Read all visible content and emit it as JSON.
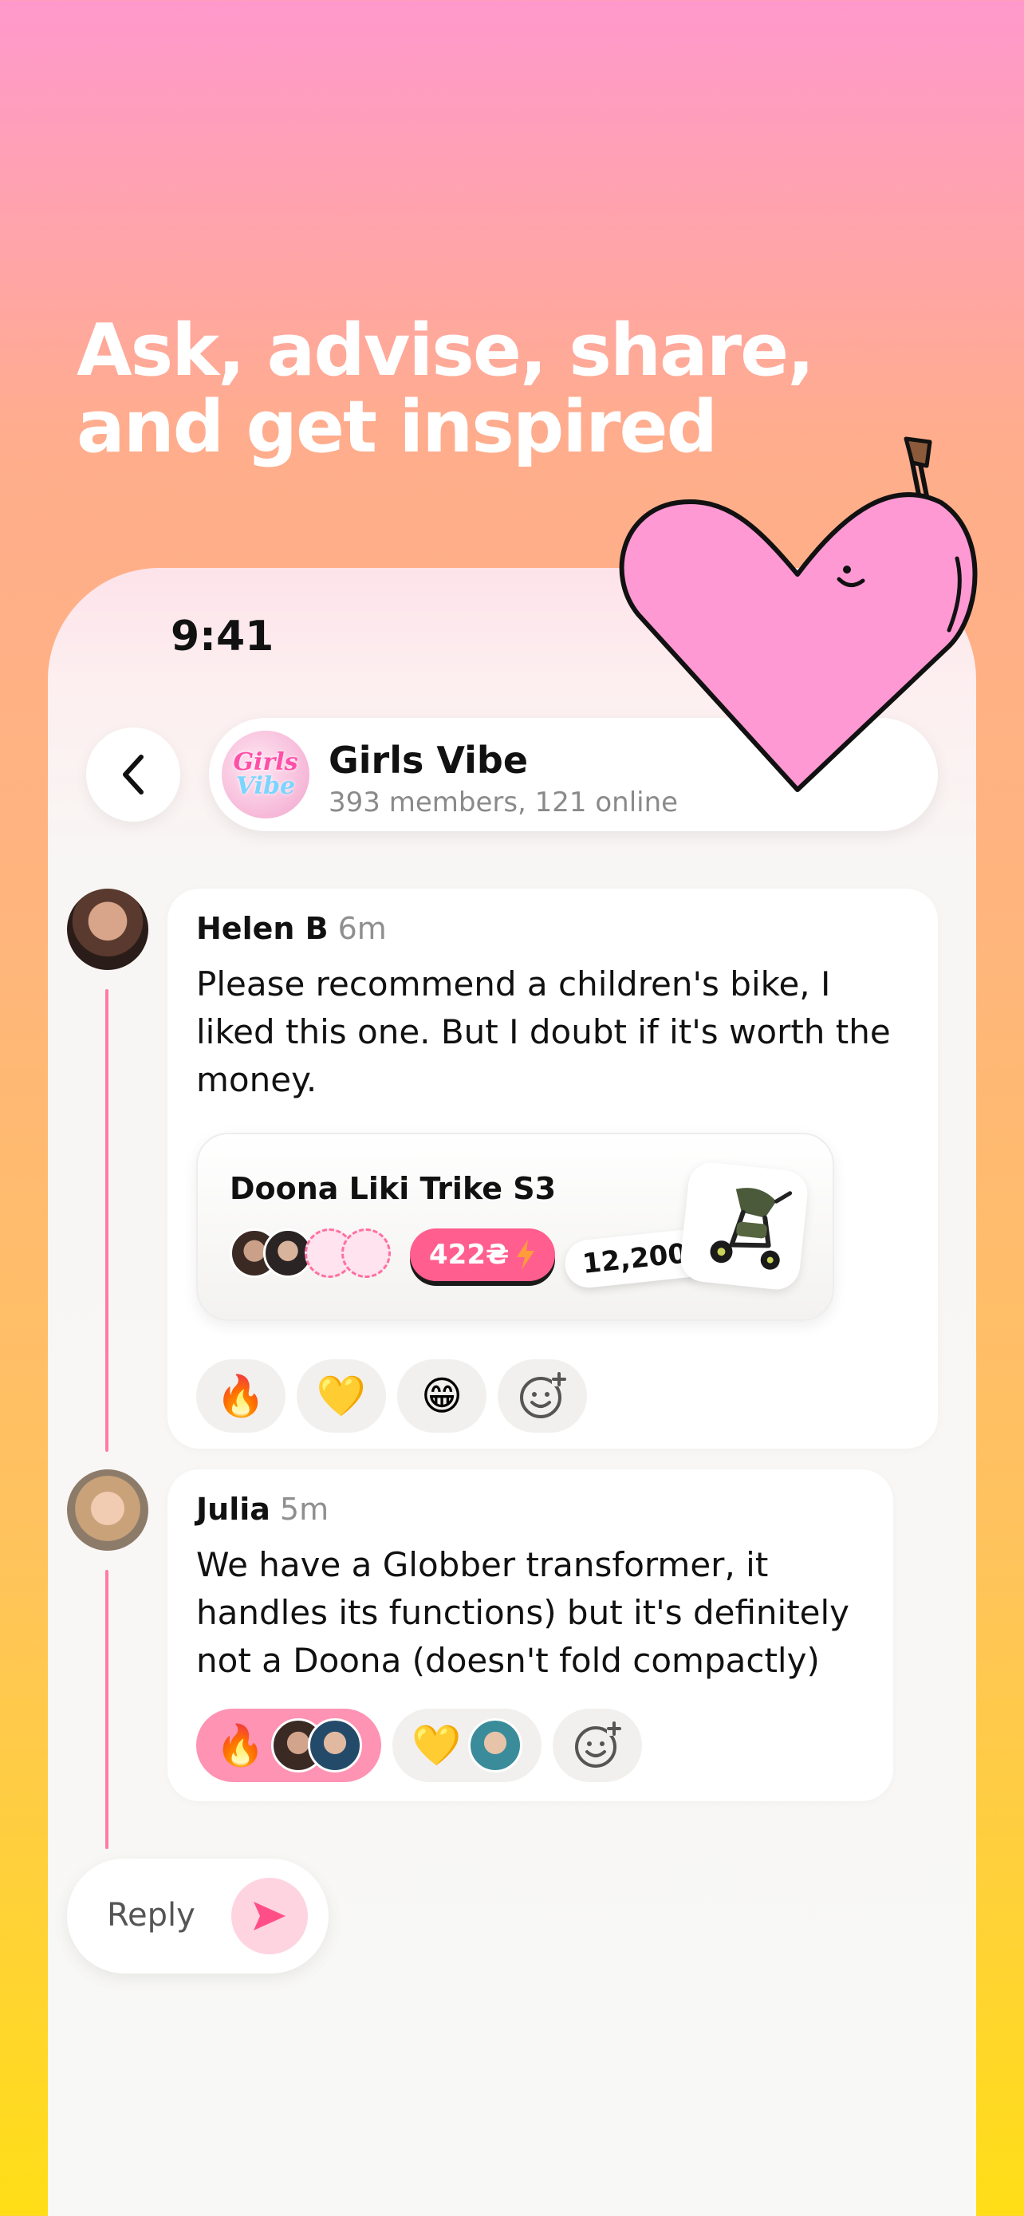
{
  "headline": "Ask, advise, share, and get inspired",
  "status_bar": {
    "time": "9:41"
  },
  "chat_header": {
    "avatar_text_line1": "Girls",
    "avatar_text_line2": "Vibe",
    "title": "Girls Vibe",
    "subtitle": "393 members, 121 online"
  },
  "messages": [
    {
      "author": "Helen B",
      "ago": "6m",
      "text": "Please recommend a children's bike, I liked this one. But I doubt if it's worth the money.",
      "product": {
        "name": "Doona Liki Trike S3",
        "group_price": "422₴",
        "price": "12,200 ₴"
      },
      "reactions": [
        "🔥",
        "💛",
        "😁"
      ]
    },
    {
      "author": "Julia",
      "ago": "5m",
      "text": "We have a Globber transformer, it handles its functions) but it's definitely not a Doona (doesn't fold compactly)",
      "reactions": [
        "🔥",
        "💛"
      ]
    }
  ],
  "reply": {
    "label": "Reply"
  },
  "colors": {
    "accent_pink": "#ff5e8e",
    "thread_line": "#ff7aa8",
    "heart_fill": "#ff99d4"
  },
  "icons": [
    "back-chevron-icon",
    "add-reaction-icon",
    "send-icon",
    "lightning-icon"
  ]
}
